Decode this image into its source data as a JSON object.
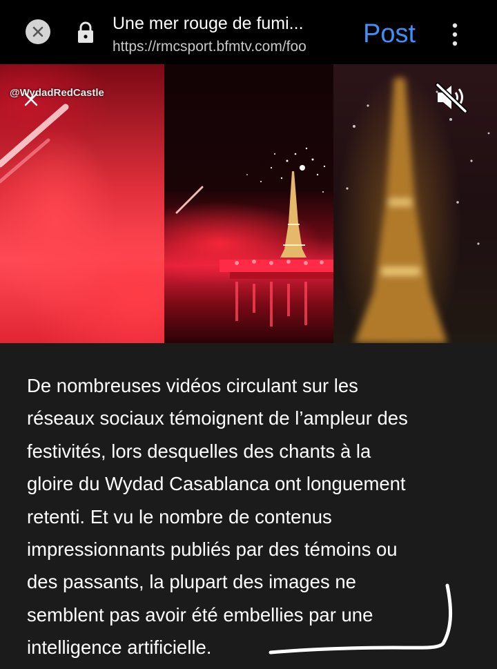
{
  "browser_bar": {
    "title": "Une mer rouge de fumi...",
    "url": "https://rmcsport.bfmtv.com/foo",
    "post_label": "Post"
  },
  "video": {
    "watermark": "@WydadRedCastle"
  },
  "article": {
    "lines": [
      "De nombreuses vidéos circulant sur les",
      "réseaux sociaux témoignent de l’ampleur des",
      "festivités, lors desquelles des chants à la",
      "gloire du Wydad Casablanca ont longuement",
      "retenti. Et vu le nombre de contenus",
      "impressionnants publiés par des témoins ou",
      "des passants, la plupart des images ne",
      "semblent pas avoir été embellies par une",
      "intelligence artificielle."
    ]
  },
  "colors": {
    "post_accent": "#3f8ff7",
    "page_background": "#1b1b1b",
    "scribble": "#ffffff"
  },
  "icons": [
    "close-icon",
    "lock-icon",
    "more-icon",
    "x-logo-icon",
    "mute-icon"
  ]
}
